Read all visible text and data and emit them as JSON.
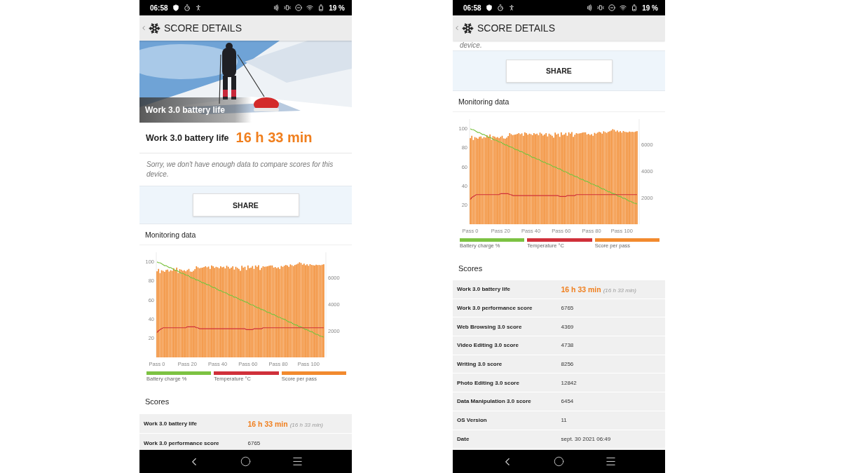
{
  "phones": [
    {
      "status_bar": {
        "time": "06:58",
        "battery": "19 %"
      },
      "header": {
        "title": "SCORE DETAILS"
      },
      "hero": {
        "kind": "picture",
        "caption": "Work 3.0 battery life"
      },
      "result": {
        "label": "Work 3.0 battery life",
        "value": "16 h 33 min"
      },
      "note": "Sorry, we don't have enough data to compare scores for this device.",
      "share_button": "SHARE",
      "monitoring": {
        "title": "Monitoring data",
        "bar_chart": {
          "chart_data": {
            "type": "bar",
            "ylim": [
              0,
              7960
            ],
            "yticks": [
              2000,
              4000,
              6000
            ],
            "categories": [
              "Pass 0",
              null,
              null,
              null,
              null,
              null,
              null,
              null,
              null,
              null,
              null,
              null,
              null,
              null,
              null,
              null,
              null,
              null,
              null,
              null,
              "Pass 20",
              null,
              null,
              null,
              null,
              null,
              null,
              null,
              null,
              null,
              null,
              null,
              null,
              null,
              null,
              null,
              null,
              null,
              null,
              null,
              "Pass 40",
              null,
              null,
              null,
              null,
              null,
              null,
              null,
              null,
              null,
              null,
              null,
              null,
              null,
              null,
              null,
              null,
              null,
              null,
              null,
              "Pass 60",
              null,
              null,
              null,
              null,
              null,
              null,
              null,
              null,
              null,
              null,
              null,
              null,
              null,
              null,
              null,
              null,
              null,
              null,
              null,
              "Pass 80",
              null,
              null,
              null,
              null,
              null,
              null,
              null,
              null,
              null,
              null,
              null,
              null,
              null,
              null,
              null,
              null,
              null,
              null,
              null,
              "Pass 100",
              null,
              null,
              null,
              null,
              null,
              null,
              null,
              null,
              null,
              null
            ],
            "series": [
              {
                "name": "Score per pass",
                "color": "#f28a2e",
                "values": [
                  6520,
                  6700,
                  6380,
                  6600,
                  6550,
                  6480,
                  6620,
                  6650,
                  6500,
                  6600,
                  6560,
                  6750,
                  6620,
                  6800,
                  6400,
                  6680,
                  6640,
                  6560,
                  6600,
                  6520,
                  6620,
                  6700,
                  6500,
                  6480,
                  6560,
                  6680,
                  6900,
                  6820,
                  6750,
                  6780,
                  6800,
                  6840,
                  6900,
                  6820,
                  6880,
                  6700,
                  6960,
                  6900,
                  6780,
                  6860,
                  6820,
                  6750,
                  6900,
                  6820,
                  6860,
                  6740,
                  6940,
                  6860,
                  6720,
                  6800,
                  6900,
                  6650,
                  6860,
                  6780,
                  6700,
                  6560,
                  6940,
                  6800,
                  6860,
                  6620,
                  6960,
                  6760,
                  6800,
                  6920,
                  6700,
                  6960,
                  6860,
                  6980,
                  6620,
                  6780,
                  6900,
                  6860,
                  6880,
                  6900,
                  6940,
                  6960,
                  6960,
                  6800,
                  6840,
                  6760,
                  6820,
                  6700,
                  6920,
                  6860,
                  6940,
                  7000,
                  6960,
                  6860,
                  7040,
                  6980,
                  6920,
                  7000,
                  7040,
                  7100,
                  7200,
                  7150,
                  7020,
                  7100,
                  6980,
                  7050,
                  6940,
                  7060,
                  7000,
                  6980,
                  6960,
                  7020,
                  6990,
                  7000,
                  6980,
                  7020,
                  7050
                ]
              }
            ]
          }
        },
        "line_chart": {
          "chart_data": {
            "type": "line",
            "ylim": [
              0,
              110
            ],
            "yticks": [
              20,
              40,
              60,
              80,
              100
            ],
            "categories": [
              null,
              null,
              null,
              null,
              null,
              null,
              null,
              null,
              null,
              null,
              null,
              null,
              null,
              null,
              null,
              null,
              null,
              null,
              null,
              null,
              null,
              null,
              null,
              null,
              null,
              null,
              null,
              null,
              null,
              null,
              null,
              null,
              null,
              null,
              null,
              null,
              null,
              null,
              null,
              null,
              null,
              null,
              null,
              null,
              null,
              null,
              null,
              null,
              null,
              null,
              null,
              null,
              null,
              null,
              null,
              null,
              null,
              null,
              null,
              null,
              null,
              null,
              null,
              null,
              null,
              null,
              null,
              null,
              null,
              null,
              null,
              null,
              null,
              null,
              null,
              null,
              null,
              null,
              null,
              null,
              null,
              null,
              null,
              null,
              null,
              null,
              null,
              null,
              null,
              null,
              null,
              null,
              null,
              null,
              null,
              null,
              null,
              null,
              null,
              null,
              null,
              null,
              null,
              null,
              null,
              null,
              null,
              null,
              null,
              null,
              null
            ],
            "series": [
              {
                "name": "Battery charge %",
                "color": "#7cc242",
                "values": [
                  100,
                  99,
                  99,
                  98,
                  97,
                  96,
                  96,
                  95,
                  94,
                  94,
                  93,
                  92,
                  91,
                  91,
                  90,
                  89,
                  88,
                  88,
                  87,
                  86,
                  86,
                  85,
                  84,
                  83,
                  83,
                  82,
                  81,
                  81,
                  80,
                  79,
                  78,
                  78,
                  77,
                  76,
                  76,
                  75,
                  74,
                  73,
                  73,
                  72,
                  71,
                  70,
                  70,
                  69,
                  68,
                  68,
                  67,
                  66,
                  65,
                  65,
                  64,
                  63,
                  63,
                  62,
                  61,
                  60,
                  60,
                  59,
                  58,
                  58,
                  57,
                  56,
                  55,
                  55,
                  54,
                  53,
                  52,
                  52,
                  51,
                  50,
                  50,
                  49,
                  48,
                  47,
                  47,
                  46,
                  45,
                  45,
                  44,
                  43,
                  42,
                  42,
                  41,
                  40,
                  40,
                  39,
                  38,
                  37,
                  37,
                  36,
                  35,
                  34,
                  34,
                  33,
                  32,
                  32,
                  31,
                  30,
                  29,
                  29,
                  28,
                  27,
                  27,
                  26,
                  25,
                  24,
                  24,
                  23,
                  22,
                  22,
                  21
                ]
              },
              {
                "name": "Temperature °C",
                "color": "#d0303a",
                "values": [
                  26,
                  28,
                  29,
                  30,
                  31,
                  31,
                  31,
                  31,
                  31,
                  31,
                  31,
                  31,
                  31,
                  31,
                  31,
                  31,
                  31,
                  31,
                  31,
                  31,
                  32,
                  32,
                  32,
                  32,
                  32,
                  32,
                  31,
                  31,
                  30,
                  30,
                  30,
                  30,
                  30,
                  30,
                  30,
                  30,
                  30,
                  30,
                  30,
                  30,
                  30,
                  30,
                  30,
                  30,
                  30,
                  30,
                  30,
                  30,
                  30,
                  30,
                  30,
                  30,
                  30,
                  30,
                  30,
                  30,
                  30,
                  30,
                  30,
                  29,
                  29,
                  29,
                  29,
                  29,
                  30,
                  30,
                  30,
                  30,
                  30,
                  30,
                  31,
                  31,
                  31,
                  31,
                  31,
                  31,
                  31,
                  31,
                  31,
                  31,
                  31,
                  31,
                  31,
                  31,
                  31,
                  31,
                  31,
                  31,
                  31,
                  31,
                  31,
                  31,
                  31,
                  31,
                  31,
                  31,
                  31,
                  31,
                  31,
                  31,
                  31,
                  31,
                  31,
                  31,
                  31,
                  31,
                  31,
                  31,
                  31,
                  31,
                  31
                ]
              }
            ]
          }
        }
      },
      "scores": {
        "title": "Scores",
        "rows": [
          {
            "kind": "main",
            "label": "Work 3.0 battery life",
            "value": "16 h 33 min",
            "detail": "(16 h 33 min)"
          },
          {
            "kind": "plain",
            "label": "Work 3.0 performance score",
            "value": "6765"
          }
        ]
      }
    },
    {
      "status_bar": {
        "time": "06:58",
        "battery": "19 %"
      },
      "header": {
        "title": "SCORE DETAILS"
      },
      "note": "device.",
      "share_button": "SHARE",
      "monitoring": {
        "title": "Monitoring data",
        "bar_chart": {
          "chart_data": {
            "type": "bar",
            "ylim": [
              0,
              7960
            ],
            "yticks": [
              2000,
              4000,
              6000
            ],
            "categories": [
              "Pass 0",
              null,
              null,
              null,
              null,
              null,
              null,
              null,
              null,
              null,
              null,
              null,
              null,
              null,
              null,
              null,
              null,
              null,
              null,
              null,
              "Pass 20",
              null,
              null,
              null,
              null,
              null,
              null,
              null,
              null,
              null,
              null,
              null,
              null,
              null,
              null,
              null,
              null,
              null,
              null,
              null,
              "Pass 40",
              null,
              null,
              null,
              null,
              null,
              null,
              null,
              null,
              null,
              null,
              null,
              null,
              null,
              null,
              null,
              null,
              null,
              null,
              null,
              "Pass 60",
              null,
              null,
              null,
              null,
              null,
              null,
              null,
              null,
              null,
              null,
              null,
              null,
              null,
              null,
              null,
              null,
              null,
              null,
              null,
              "Pass 80",
              null,
              null,
              null,
              null,
              null,
              null,
              null,
              null,
              null,
              null,
              null,
              null,
              null,
              null,
              null,
              null,
              null,
              null,
              null,
              "Pass 100",
              null,
              null,
              null,
              null,
              null,
              null,
              null,
              null,
              null,
              null
            ],
            "series": [
              {
                "name": "Score per pass",
                "color": "#f28a2e",
                "values": [
                  6520,
                  6700,
                  6380,
                  6600,
                  6550,
                  6480,
                  6620,
                  6650,
                  6500,
                  6600,
                  6560,
                  6750,
                  6620,
                  6800,
                  6400,
                  6680,
                  6640,
                  6560,
                  6600,
                  6520,
                  6620,
                  6700,
                  6500,
                  6480,
                  6560,
                  6680,
                  6900,
                  6820,
                  6750,
                  6780,
                  6800,
                  6840,
                  6900,
                  6820,
                  6880,
                  6700,
                  6960,
                  6900,
                  6780,
                  6860,
                  6820,
                  6750,
                  6900,
                  6820,
                  6860,
                  6740,
                  6940,
                  6860,
                  6720,
                  6800,
                  6900,
                  6650,
                  6860,
                  6780,
                  6700,
                  6560,
                  6940,
                  6800,
                  6860,
                  6620,
                  6960,
                  6760,
                  6800,
                  6920,
                  6700,
                  6960,
                  6860,
                  6980,
                  6620,
                  6780,
                  6900,
                  6860,
                  6880,
                  6900,
                  6940,
                  6960,
                  6960,
                  6800,
                  6840,
                  6760,
                  6820,
                  6700,
                  6920,
                  6860,
                  6940,
                  7000,
                  6960,
                  6860,
                  7040,
                  6980,
                  6920,
                  7000,
                  7040,
                  7100,
                  7200,
                  7150,
                  7020,
                  7100,
                  6980,
                  7050,
                  6940,
                  7060,
                  7000,
                  6980,
                  6960,
                  7020,
                  6990,
                  7000,
                  6980,
                  7020,
                  7050
                ]
              }
            ]
          }
        },
        "line_chart": {
          "chart_data": {
            "type": "line",
            "ylim": [
              0,
              110
            ],
            "yticks": [
              20,
              40,
              60,
              80,
              100
            ],
            "categories": [
              null,
              null,
              null,
              null,
              null,
              null,
              null,
              null,
              null,
              null,
              null,
              null,
              null,
              null,
              null,
              null,
              null,
              null,
              null,
              null,
              null,
              null,
              null,
              null,
              null,
              null,
              null,
              null,
              null,
              null,
              null,
              null,
              null,
              null,
              null,
              null,
              null,
              null,
              null,
              null,
              null,
              null,
              null,
              null,
              null,
              null,
              null,
              null,
              null,
              null,
              null,
              null,
              null,
              null,
              null,
              null,
              null,
              null,
              null,
              null,
              null,
              null,
              null,
              null,
              null,
              null,
              null,
              null,
              null,
              null,
              null,
              null,
              null,
              null,
              null,
              null,
              null,
              null,
              null,
              null,
              null,
              null,
              null,
              null,
              null,
              null,
              null,
              null,
              null,
              null,
              null,
              null,
              null,
              null,
              null,
              null,
              null,
              null,
              null,
              null,
              null,
              null,
              null,
              null,
              null,
              null,
              null,
              null,
              null,
              null,
              null
            ],
            "series": [
              {
                "name": "Battery charge %",
                "color": "#7cc242",
                "values": [
                  100,
                  99,
                  99,
                  98,
                  97,
                  96,
                  96,
                  95,
                  94,
                  94,
                  93,
                  92,
                  91,
                  91,
                  90,
                  89,
                  88,
                  88,
                  87,
                  86,
                  86,
                  85,
                  84,
                  83,
                  83,
                  82,
                  81,
                  81,
                  80,
                  79,
                  78,
                  78,
                  77,
                  76,
                  76,
                  75,
                  74,
                  73,
                  73,
                  72,
                  71,
                  70,
                  70,
                  69,
                  68,
                  68,
                  67,
                  66,
                  65,
                  65,
                  64,
                  63,
                  63,
                  62,
                  61,
                  60,
                  60,
                  59,
                  58,
                  58,
                  57,
                  56,
                  55,
                  55,
                  54,
                  53,
                  52,
                  52,
                  51,
                  50,
                  50,
                  49,
                  48,
                  47,
                  47,
                  46,
                  45,
                  45,
                  44,
                  43,
                  42,
                  42,
                  41,
                  40,
                  40,
                  39,
                  38,
                  37,
                  37,
                  36,
                  35,
                  34,
                  34,
                  33,
                  32,
                  32,
                  31,
                  30,
                  29,
                  29,
                  28,
                  27,
                  27,
                  26,
                  25,
                  24,
                  24,
                  23,
                  22,
                  22,
                  21
                ]
              },
              {
                "name": "Temperature °C",
                "color": "#d0303a",
                "values": [
                  26,
                  28,
                  29,
                  30,
                  31,
                  31,
                  31,
                  31,
                  31,
                  31,
                  31,
                  31,
                  31,
                  31,
                  31,
                  31,
                  31,
                  31,
                  31,
                  31,
                  32,
                  32,
                  32,
                  32,
                  32,
                  32,
                  31,
                  31,
                  30,
                  30,
                  30,
                  30,
                  30,
                  30,
                  30,
                  30,
                  30,
                  30,
                  30,
                  30,
                  30,
                  30,
                  30,
                  30,
                  30,
                  30,
                  30,
                  30,
                  30,
                  30,
                  30,
                  30,
                  30,
                  30,
                  30,
                  30,
                  30,
                  30,
                  30,
                  29,
                  29,
                  29,
                  29,
                  29,
                  30,
                  30,
                  30,
                  30,
                  30,
                  30,
                  31,
                  31,
                  31,
                  31,
                  31,
                  31,
                  31,
                  31,
                  31,
                  31,
                  31,
                  31,
                  31,
                  31,
                  31,
                  31,
                  31,
                  31,
                  31,
                  31,
                  31,
                  31,
                  31,
                  31,
                  31,
                  31,
                  31,
                  31,
                  31,
                  31,
                  31,
                  31,
                  31,
                  31,
                  31,
                  31,
                  31,
                  31,
                  31,
                  31,
                  31
                ]
              }
            ]
          }
        }
      },
      "scores": {
        "title": "Scores",
        "rows": [
          {
            "kind": "main",
            "label": "Work 3.0 battery life",
            "value": "16 h 33 min",
            "detail": "(16 h 33 min)"
          },
          {
            "kind": "plain",
            "label": "Work 3.0 performance score",
            "value": "6765"
          },
          {
            "kind": "plain",
            "label": "Web Browsing 3.0 score",
            "value": "4369"
          },
          {
            "kind": "plain",
            "label": "Video Editing 3.0 score",
            "value": "4738"
          },
          {
            "kind": "plain",
            "label": "Writing 3.0 score",
            "value": "8256"
          },
          {
            "kind": "plain",
            "label": "Photo Editing 3.0 score",
            "value": "12842"
          },
          {
            "kind": "plain",
            "label": "Data Manipulation 3.0 score",
            "value": "6454"
          },
          {
            "kind": "plain",
            "label": "OS Version",
            "value": "11"
          },
          {
            "kind": "plain",
            "label": "Date",
            "value": "sept. 30 2021 06:49"
          }
        ]
      }
    }
  ]
}
